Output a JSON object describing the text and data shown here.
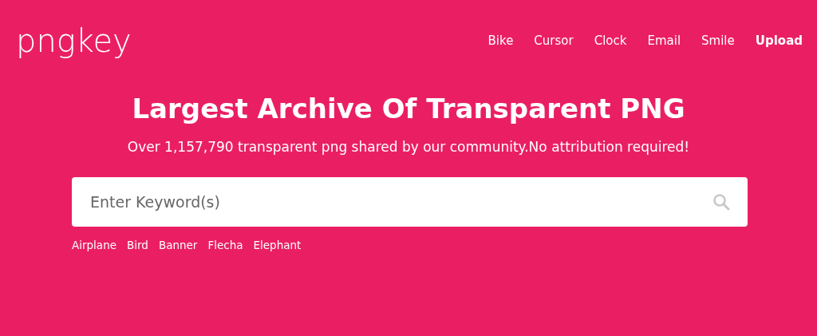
{
  "header": {
    "logo": "pngkey",
    "nav": [
      {
        "label": "Bike",
        "kind": "link"
      },
      {
        "label": "Cursor",
        "kind": "link"
      },
      {
        "label": "Clock",
        "kind": "link"
      },
      {
        "label": "Email",
        "kind": "link"
      },
      {
        "label": "Smile",
        "kind": "link"
      },
      {
        "label": "Upload",
        "kind": "action"
      }
    ]
  },
  "hero": {
    "title": "Largest Archive Of Transparent PNG",
    "subtitle": "Over 1,157,790 transparent png shared by our community.No attribution required!"
  },
  "search": {
    "placeholder": "Enter Keyword(s)"
  },
  "tags": [
    "Airplane",
    "Bird",
    "Banner",
    "Flecha",
    "Elephant"
  ]
}
